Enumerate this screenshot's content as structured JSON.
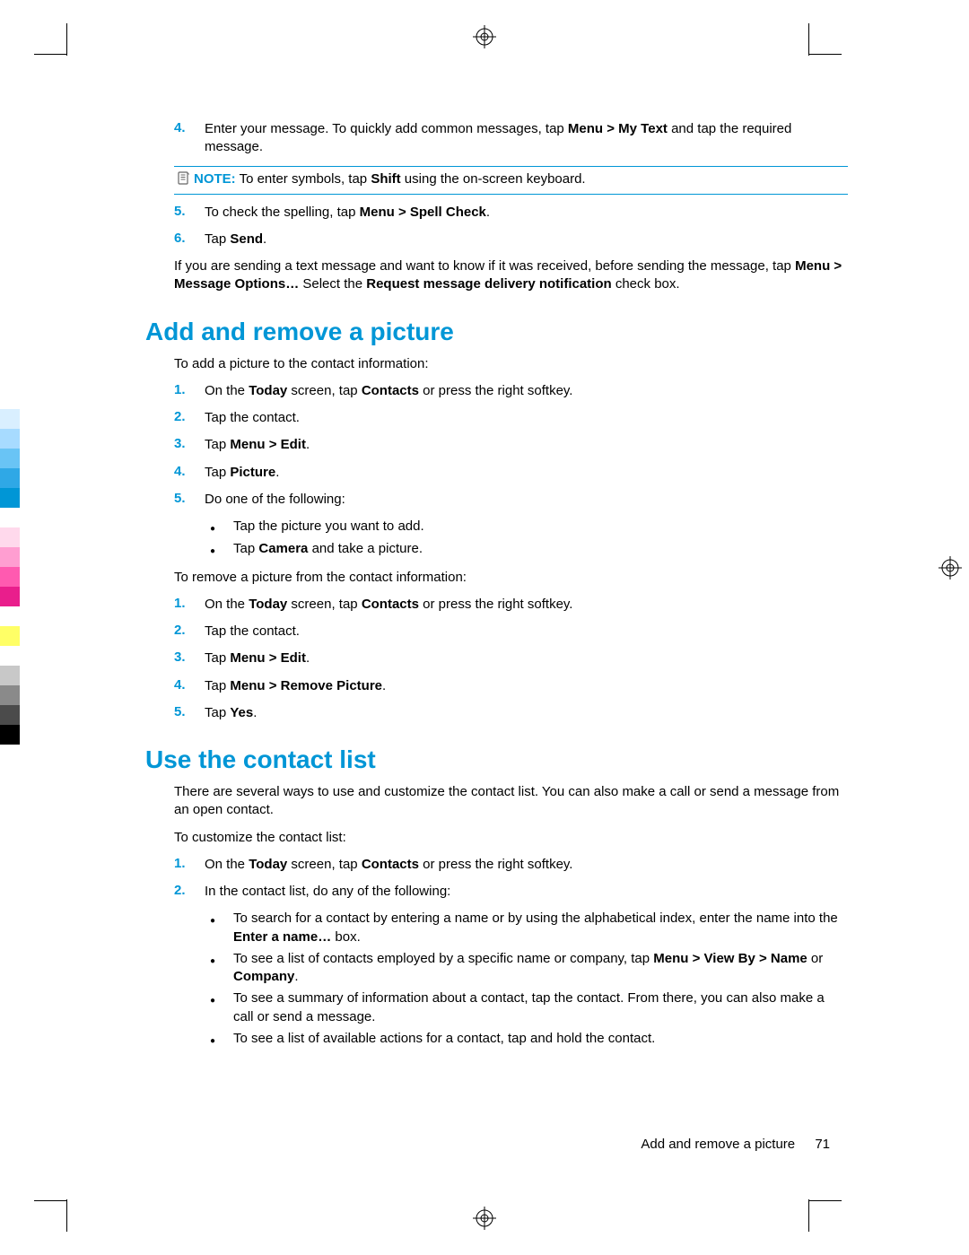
{
  "intro_steps": [
    {
      "num": "4.",
      "html": "Enter your message. To quickly add common messages, tap <b>Menu > My Text</b> and tap the required message."
    }
  ],
  "note": {
    "label": "NOTE:",
    "html": "To enter symbols, tap <b>Shift</b> using the on-screen keyboard."
  },
  "intro_steps2": [
    {
      "num": "5.",
      "html": "To check the spelling, tap <b>Menu > Spell Check</b>."
    },
    {
      "num": "6.",
      "html": "Tap <b>Send</b>."
    }
  ],
  "intro_tail": "If you are sending a text message and want to know if it was received, before sending the message, tap <b>Menu > Message Options…</b> Select the <b>Request message delivery notification</b> check box.",
  "section1": {
    "title": "Add and remove a picture",
    "lead1": "To add a picture to the contact information:",
    "steps1": [
      {
        "num": "1.",
        "html": "On the <b>Today</b> screen, tap <b>Contacts</b> or press the right softkey."
      },
      {
        "num": "2.",
        "html": "Tap the contact."
      },
      {
        "num": "3.",
        "html": "Tap <b>Menu > Edit</b>."
      },
      {
        "num": "4.",
        "html": "Tap <b>Picture</b>."
      },
      {
        "num": "5.",
        "html": "Do one of the following:"
      }
    ],
    "bullets1": [
      {
        "html": "Tap the picture you want to add."
      },
      {
        "html": "Tap <b>Camera</b> and take a picture."
      }
    ],
    "lead2": "To remove a picture from the contact information:",
    "steps2": [
      {
        "num": "1.",
        "html": "On the <b>Today</b> screen, tap <b>Contacts</b> or press the right softkey."
      },
      {
        "num": "2.",
        "html": "Tap the contact."
      },
      {
        "num": "3.",
        "html": "Tap <b>Menu > Edit</b>."
      },
      {
        "num": "4.",
        "html": "Tap <b>Menu > Remove Picture</b>."
      },
      {
        "num": "5.",
        "html": "Tap <b>Yes</b>."
      }
    ]
  },
  "section2": {
    "title": "Use the contact list",
    "lead1": "There are several ways to use and customize the contact list. You can also make a call or send a message from an open contact.",
    "lead2": "To customize the contact list:",
    "steps": [
      {
        "num": "1.",
        "html": "On the <b>Today</b> screen, tap <b>Contacts</b> or press the right softkey."
      },
      {
        "num": "2.",
        "html": "In the contact list, do any of the following:"
      }
    ],
    "bullets": [
      {
        "html": "To search for a contact by entering a name or by using the alphabetical index, enter the name into the <b>Enter a name…</b> box."
      },
      {
        "html": "To see a list of contacts employed by a specific name or company, tap <b>Menu > View By > Name</b> or <b>Company</b>."
      },
      {
        "html": "To see a summary of information about a contact, tap the contact. From there, you can also make a call or send a message."
      },
      {
        "html": "To see a list of available actions for a contact, tap and hold the contact."
      }
    ]
  },
  "footer": {
    "section": "Add and remove a picture",
    "page": "71"
  },
  "color_bars": [
    "#ffffff",
    "#d9efff",
    "#a7dbff",
    "#69c4f5",
    "#2fa8e6",
    "#0096d6",
    "#ffffff",
    "#ffd9ec",
    "#ff9ed1",
    "#ff5ab0",
    "#e91e8c",
    "#ffffff",
    "#ffff66",
    "#ffffff",
    "#c8c8c8",
    "#8a8a8a",
    "#4b4b4b",
    "#000000"
  ]
}
